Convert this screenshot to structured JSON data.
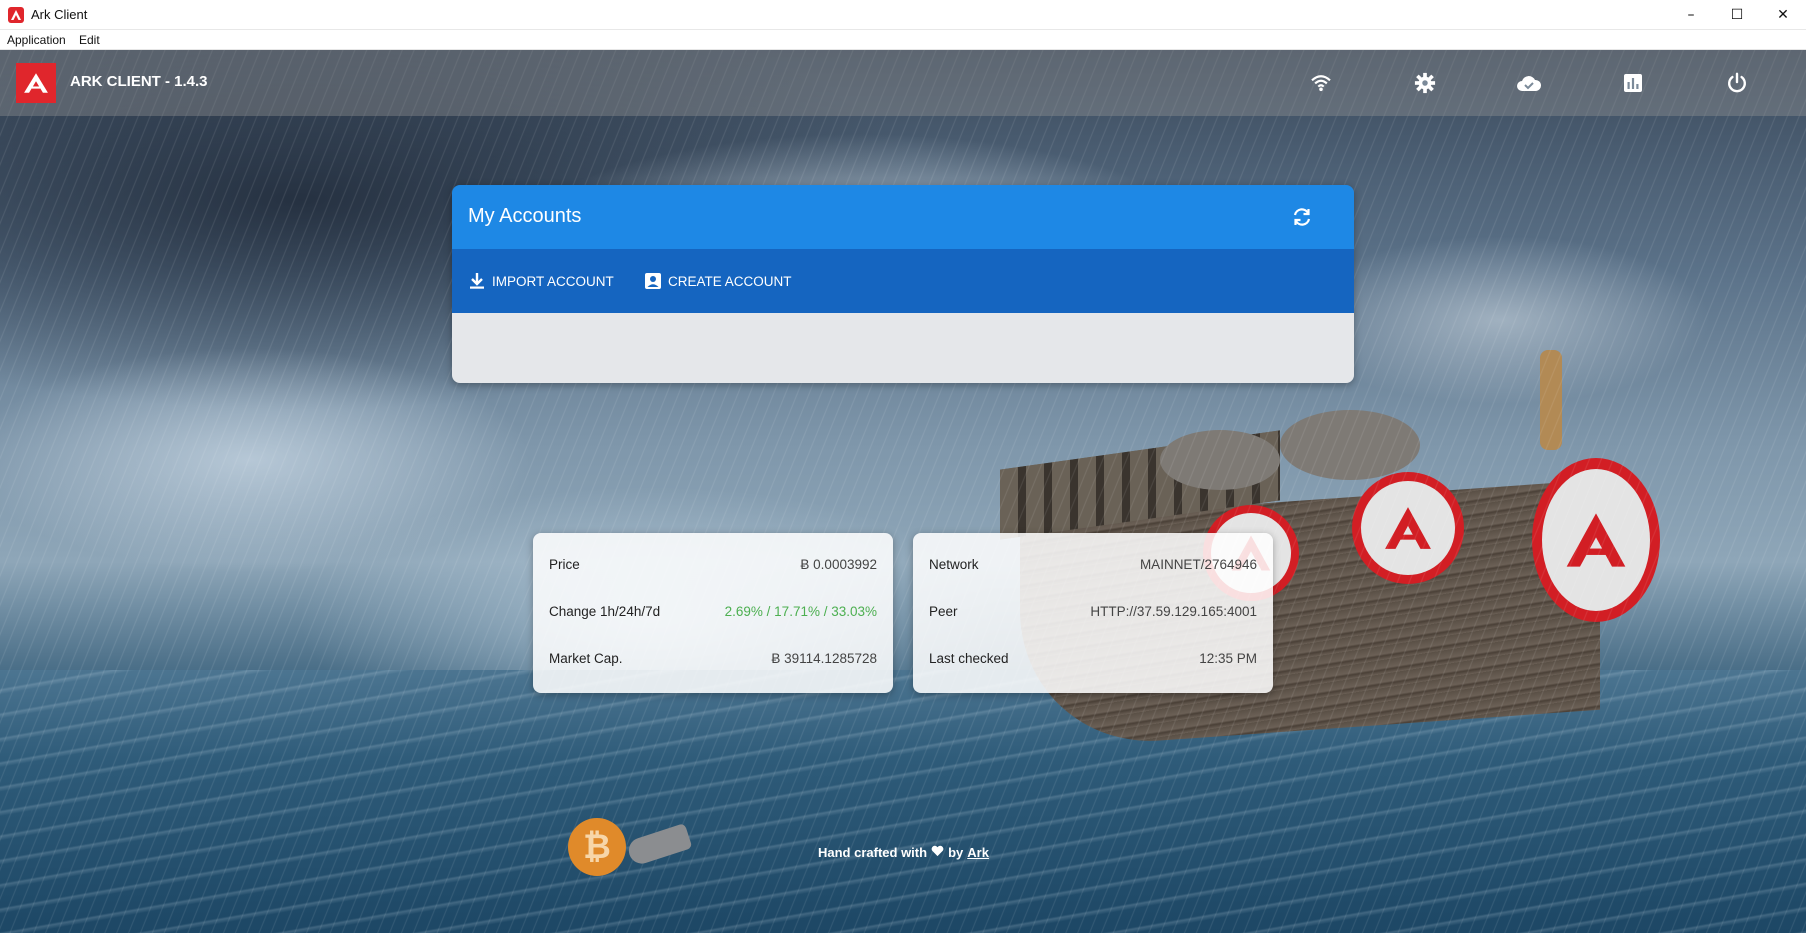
{
  "window": {
    "title": "Ark Client",
    "controls": {
      "minimize": "–",
      "maximize": "☐",
      "close": "✕"
    }
  },
  "menu": {
    "items": [
      "Application",
      "Edit"
    ]
  },
  "header": {
    "brand": "ARK CLIENT - 1.4.3",
    "icons": [
      "wifi-icon",
      "gear-icon",
      "cloud-done-icon",
      "bar-chart-icon",
      "power-icon"
    ]
  },
  "accounts": {
    "title": "My Accounts",
    "import_label": "IMPORT ACCOUNT",
    "create_label": "CREATE ACCOUNT"
  },
  "market": {
    "price_label": "Price",
    "price_value": "Ƀ 0.0003992",
    "change_label": "Change 1h/24h/7d",
    "change_value": "2.69% / 17.71% / 33.03%",
    "cap_label": "Market Cap.",
    "cap_value": "Ƀ 39114.1285728"
  },
  "network": {
    "network_label": "Network",
    "network_value": "MAINNET/2764946",
    "peer_label": "Peer",
    "peer_value": "HTTP://37.59.129.165:4001",
    "checked_label": "Last checked",
    "checked_value": "12:35 PM"
  },
  "footer": {
    "text": "Hand crafted with",
    "by": "by",
    "link": "Ark"
  },
  "colors": {
    "brand_red": "#e0262c",
    "header_blue": "#1e88e5",
    "actions_blue": "#1565c0",
    "positive_green": "#4caf50"
  }
}
